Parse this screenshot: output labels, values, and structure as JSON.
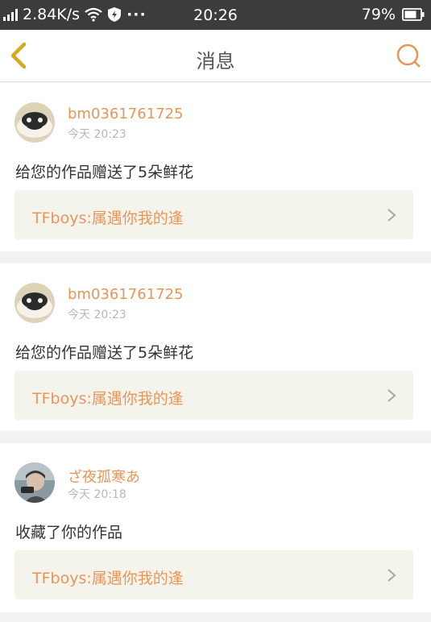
{
  "status_bar": {
    "network_speed": "2.84K/s",
    "more": "···",
    "time": "20:26",
    "battery": "79%"
  },
  "nav": {
    "title": "消息"
  },
  "messages": [
    {
      "username": "bm0361761725",
      "time": "今天 20:23",
      "text": "给您的作品赠送了5朵鲜花",
      "work": "TFboys:属遇你我的逢"
    },
    {
      "username": "bm0361761725",
      "time": "今天 20:23",
      "text": "给您的作品赠送了5朵鲜花",
      "work": "TFboys:属遇你我的逢"
    },
    {
      "username": "ざ夜孤寒あ",
      "time": "今天 20:18",
      "text": "收藏了你的作品",
      "work": "TFboys:属遇你我的逢"
    }
  ],
  "icons": {
    "back": "chevron-left-icon",
    "search": "search-icon",
    "signal": "signal-icon",
    "wifi": "wifi-icon",
    "shield": "shield-icon",
    "battery": "battery-icon",
    "chevron": "chevron-right-icon"
  },
  "colors": {
    "accent": "#e8955a",
    "back_icon": "#d4aa1e",
    "status_bar_bg": "#3c3c3c",
    "link_bg": "#f4f4ec"
  }
}
